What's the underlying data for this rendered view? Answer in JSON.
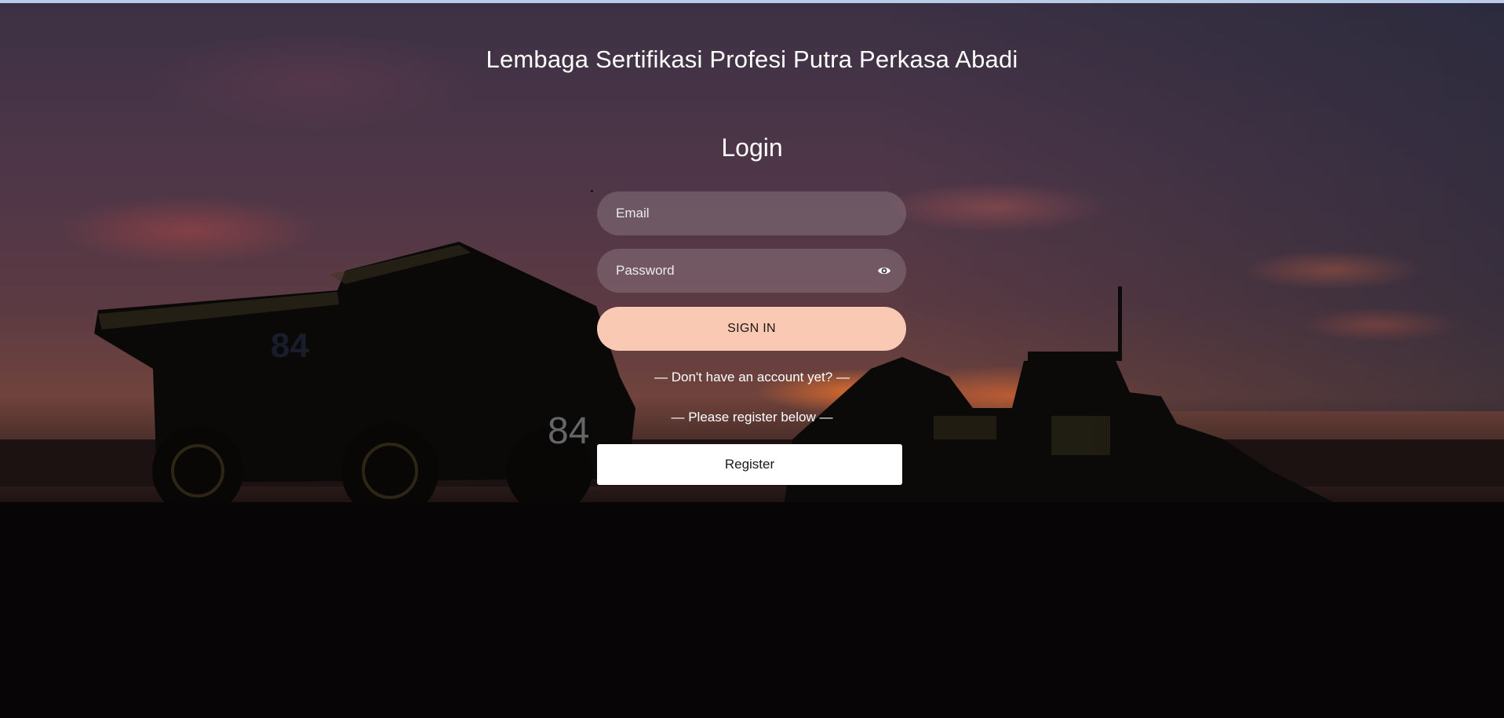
{
  "header": {
    "title": "Lembaga Sertifikasi Profesi Putra Perkasa Abadi"
  },
  "login": {
    "heading": "Login",
    "email_placeholder": "Email",
    "password_placeholder": "Password",
    "password_toggle_icon": "eye-icon",
    "sign_in_label": "SIGN IN",
    "no_account_text": "— Don't have an account yet? —",
    "register_hint_text": "— Please register below —",
    "register_label": "Register"
  },
  "colors": {
    "sign_in_button": "#f9c9b4",
    "register_button": "#ffffff",
    "input_background": "rgba(255,255,255,0.16)",
    "text": "#ffffff",
    "top_strip": "#b9cbe6"
  },
  "background": {
    "image_subject": "mining-trucks-at-sunset"
  }
}
